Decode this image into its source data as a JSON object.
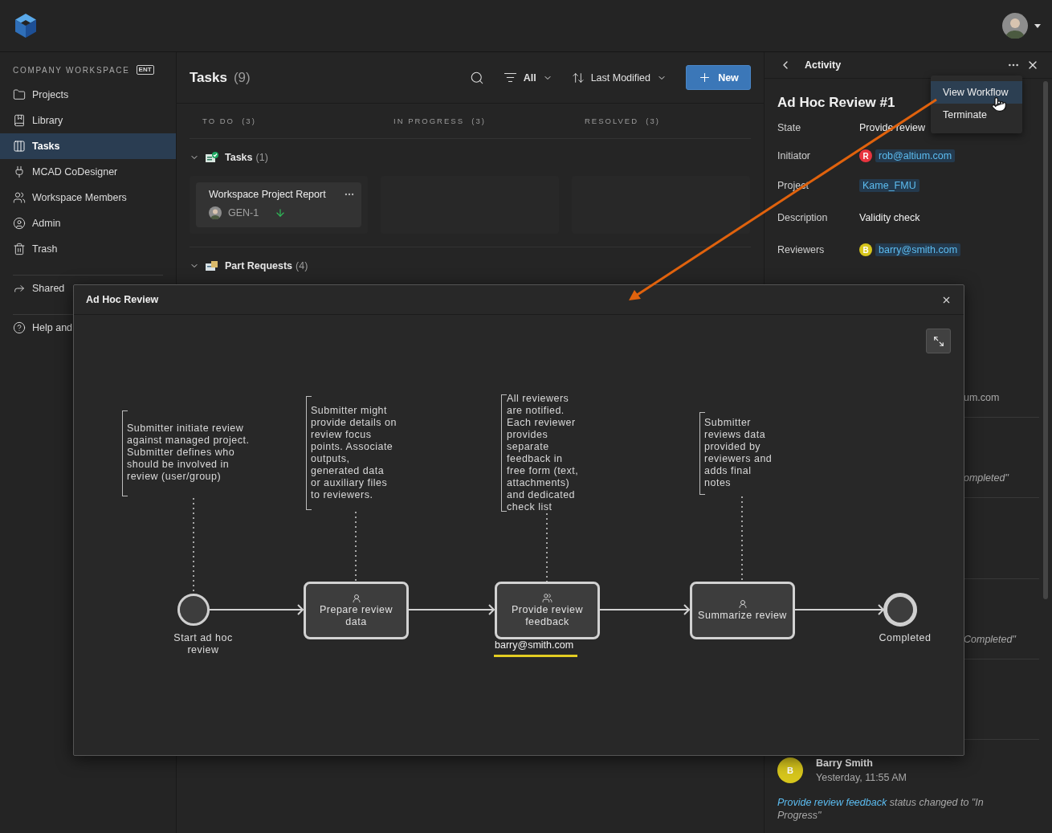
{
  "sidebar": {
    "heading": "COMPANY WORKSPACE",
    "badge": "ENT",
    "items": [
      {
        "label": "Projects",
        "selected": false
      },
      {
        "label": "Library",
        "selected": false
      },
      {
        "label": "Tasks",
        "selected": true
      },
      {
        "label": "MCAD CoDesigner",
        "selected": false
      },
      {
        "label": "Workspace Members",
        "selected": false
      },
      {
        "label": "Admin",
        "selected": false
      },
      {
        "label": "Trash",
        "selected": false
      }
    ],
    "shared": "Shared",
    "help": "Help and"
  },
  "tasks": {
    "title": "Tasks",
    "count": "(9)",
    "filter": "All",
    "sort": "Last Modified",
    "new_button": "New",
    "columns": [
      {
        "label": "TO DO",
        "count": "(3)"
      },
      {
        "label": "IN PROGRESS",
        "count": "(3)"
      },
      {
        "label": "RESOLVED",
        "count": "(3)"
      }
    ],
    "groups": [
      {
        "name": "Tasks",
        "count": "(1)",
        "kind": "tasks",
        "expanded": true,
        "cards": [
          {
            "title": "Workspace Project Report",
            "id": "GEN-1"
          }
        ]
      },
      {
        "name": "Part Requests",
        "count": "(4)",
        "kind": "parts",
        "expanded": true
      }
    ]
  },
  "activity": {
    "title": "Activity",
    "heading": "Ad Hoc Review #1",
    "fields": [
      {
        "label": "State",
        "value": "Provide review",
        "kind": "text"
      },
      {
        "label": "Initiator",
        "value": "rob@altium.com",
        "kind": "user",
        "initial": "R",
        "color": "#e8343f"
      },
      {
        "label": "Project",
        "value": "Kame_FMU",
        "kind": "link"
      },
      {
        "label": "Description",
        "value": "Validity check",
        "kind": "text"
      },
      {
        "label": "Reviewers",
        "value": "barry@smith.com",
        "kind": "user",
        "initial": "B",
        "color": "#d6c51c"
      }
    ],
    "entries": [
      {
        "kind": "plain",
        "text": "um.com"
      },
      {
        "kind": "italic",
        "text": "ompleted\""
      },
      {
        "kind": "blank"
      },
      {
        "kind": "italic",
        "text": "Completed\""
      },
      {
        "kind": "blank"
      }
    ],
    "latest": {
      "author": "Barry Smith",
      "initial": "B",
      "color": "#d6c51c",
      "time": "Yesterday, 11:55 AM",
      "link": "Provide review feedback",
      "message": " status changed to \"In Progress\""
    }
  },
  "menu": {
    "items": [
      {
        "label": "View Workflow",
        "selected": true
      },
      {
        "label": "Terminate",
        "selected": false
      }
    ]
  },
  "modal": {
    "title": "Ad Hoc Review",
    "steps": [
      {
        "kind": "start",
        "label": "Start ad hoc\nreview",
        "note": "Submitter initiate review\nagainst managed project.\nSubmitter defines who\nshould be involved in\nreview (user/group)",
        "current": false
      },
      {
        "kind": "single_task",
        "label": "Prepare review\ndata",
        "note": "Submitter might\nprovide details on\nreview focus\npoints. Associate\noutputs,\ngenerated data\nor auxiliary files\nto reviewers.",
        "current": false
      },
      {
        "kind": "group_task",
        "label": "Provide review\nfeedback",
        "note": "All reviewers\nare notified.\nEach reviewer\nprovides\nseparate\nfeedback in\nfree form (text,\nattachments)\nand dedicated\ncheck list",
        "assignee": "barry@smith.com",
        "current": true
      },
      {
        "kind": "single_task",
        "label": "Summarize review",
        "note": "Submitter\nreviews data\nprovided by\nreviewers and\nadds final\nnotes",
        "current": false
      },
      {
        "kind": "end",
        "label": "Completed",
        "current": false
      }
    ]
  }
}
